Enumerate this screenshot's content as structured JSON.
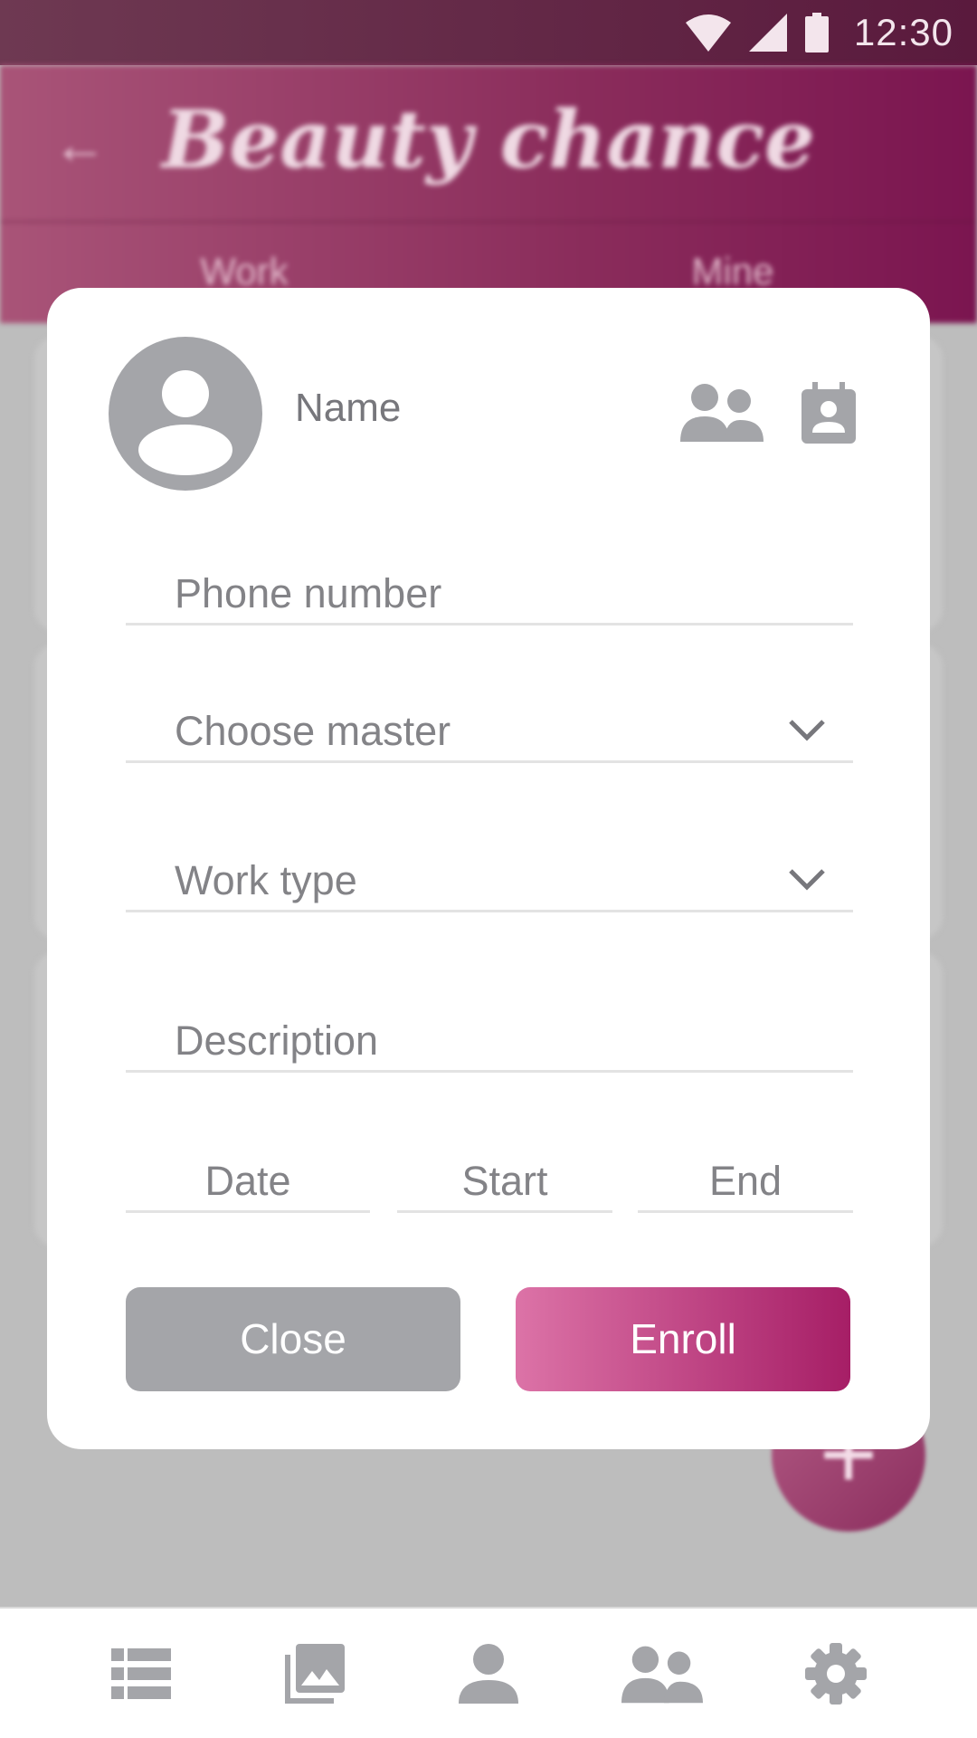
{
  "status_bar": {
    "time": "12:30",
    "wifi_icon": "wifi-icon",
    "signal_icon": "signal-icon",
    "battery_icon": "battery-icon"
  },
  "app_bar": {
    "back_icon": "arrow-back-icon",
    "title": "Beauty chance",
    "tabs": [
      {
        "label": "Work"
      },
      {
        "label": "Mine"
      }
    ]
  },
  "dialog": {
    "avatar_icon": "account-circle-icon",
    "name_placeholder": "Name",
    "header_icons": [
      "people-icon",
      "contact-calendar-icon"
    ],
    "phone_placeholder": "Phone number",
    "master_placeholder": "Choose master",
    "work_type_placeholder": "Work type",
    "description_placeholder": "Description",
    "date_placeholder": "Date",
    "start_placeholder": "Start",
    "end_placeholder": "End",
    "close_label": "Close",
    "enroll_label": "Enroll"
  },
  "fab": {
    "label": "+",
    "icon": "add-icon"
  },
  "bottom_nav": {
    "items": [
      {
        "icon": "list-icon"
      },
      {
        "icon": "photo-library-icon"
      },
      {
        "icon": "person-icon"
      },
      {
        "icon": "people-icon"
      },
      {
        "icon": "settings-icon"
      }
    ]
  },
  "colors": {
    "primary": "#a61e66",
    "primary_light": "#dc73a7",
    "status_bar": "#5a1a3d",
    "close_button": "#a4a5a9",
    "scrim": "#bdbdbd"
  }
}
